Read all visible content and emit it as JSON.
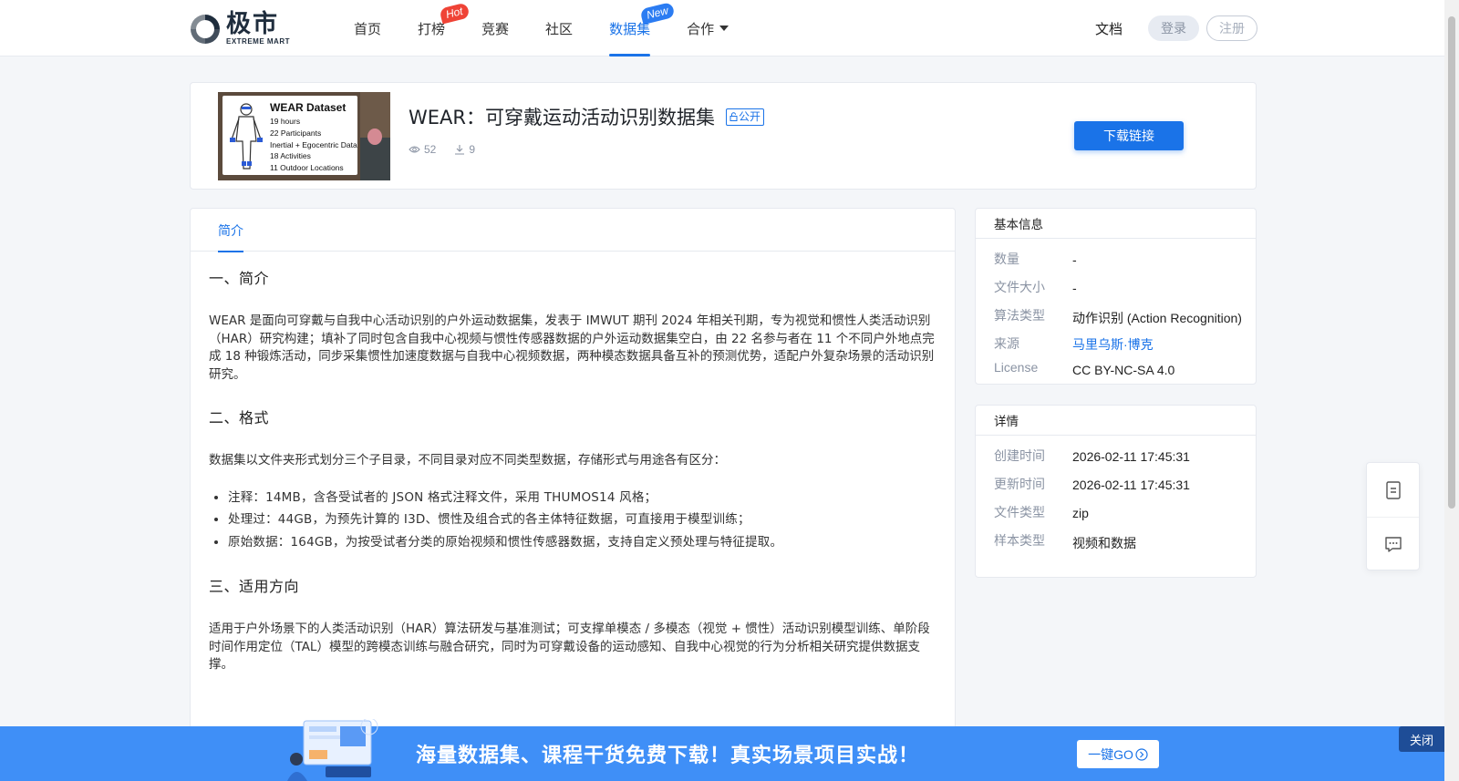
{
  "header": {
    "logo_cn": "极市",
    "logo_en": "EXTREME MART",
    "nav": [
      {
        "label": "首页"
      },
      {
        "label": "打榜",
        "badge": "Hot"
      },
      {
        "label": "竞赛"
      },
      {
        "label": "社区"
      },
      {
        "label": "数据集",
        "badge": "New",
        "active": true
      },
      {
        "label": "合作"
      }
    ],
    "docs_label": "文档",
    "login_label": "登录",
    "register_label": "注册"
  },
  "hero": {
    "thumbnail": {
      "title": "WEAR Dataset",
      "lines": [
        "19 hours",
        "22 Participants",
        "Inertial + Egocentric Data",
        "18 Activities",
        "11 Outdoor Locations"
      ]
    },
    "title": "WEAR：可穿戴运动活动识别数据集",
    "tag": "公开",
    "views": "52",
    "downloads": "9",
    "download_button": "下载链接"
  },
  "tabs": {
    "intro": "简介"
  },
  "content": {
    "s1_title": "一、简介",
    "s1_text": "WEAR 是面向可穿戴与自我中心活动识别的户外运动数据集，发表于 IMWUT 期刊 2024 年相关刊期，专为视觉和惯性人类活动识别（HAR）研究构建；填补了同时包含自我中心视频与惯性传感器数据的户外运动数据集空白，由 22 名参与者在 11 个不同户外地点完成 18 种锻炼活动，同步采集惯性加速度数据与自我中心视频数据，两种模态数据具备互补的预测优势，适配户外复杂场景的活动识别研究。",
    "s2_title": "二、格式",
    "s2_text": "数据集以文件夹形式划分三个子目录，不同目录对应不同类型数据，存储形式与用途各有区分：",
    "s2_items": [
      "注释：14MB，含各受试者的 JSON 格式注释文件，采用 THUMOS14 风格；",
      "处理过：44GB，为预先计算的 I3D、惯性及组合式的各主体特征数据，可直接用于模型训练；",
      "原始数据：164GB，为按受试者分类的原始视频和惯性传感器数据，支持自定义预处理与特征提取。"
    ],
    "s3_title": "三、适用方向",
    "s3_text": "适用于户外场景下的人类活动识别（HAR）算法研发与基准测试；可支撑单模态 / 多模态（视觉 + 惯性）活动识别模型训练、单阶段时间作用定位（TAL）模型的跨模态训练与融合研究，同时为可穿戴设备的运动感知、自我中心视觉的行为分析相关研究提供数据支撑。"
  },
  "basic_info": {
    "title": "基本信息",
    "rows": [
      {
        "k": "数量",
        "v": "-"
      },
      {
        "k": "文件大小",
        "v": "-"
      },
      {
        "k": "算法类型",
        "v": "动作识别 (Action Recognition)"
      },
      {
        "k": "来源",
        "v": "马里乌斯·博克"
      },
      {
        "k": "License",
        "v": "CC BY-NC-SA 4.0"
      }
    ]
  },
  "details": {
    "title": "详情",
    "rows": [
      {
        "k": "创建时间",
        "v": "2026-02-11 17:45:31"
      },
      {
        "k": "更新时间",
        "v": "2026-02-11 17:45:31"
      },
      {
        "k": "文件类型",
        "v": "zip"
      },
      {
        "k": "样本类型",
        "v": "视频和数据"
      }
    ]
  },
  "banner": {
    "text": "海量数据集、课程干货免费下载！真实场景项目实战！",
    "go_label": "一键GO",
    "close_label": "关闭"
  },
  "colors": {
    "accent": "#1a73e8",
    "banner": "#3f8ff7",
    "hot": "#ef4336",
    "new": "#2b7cf2"
  }
}
